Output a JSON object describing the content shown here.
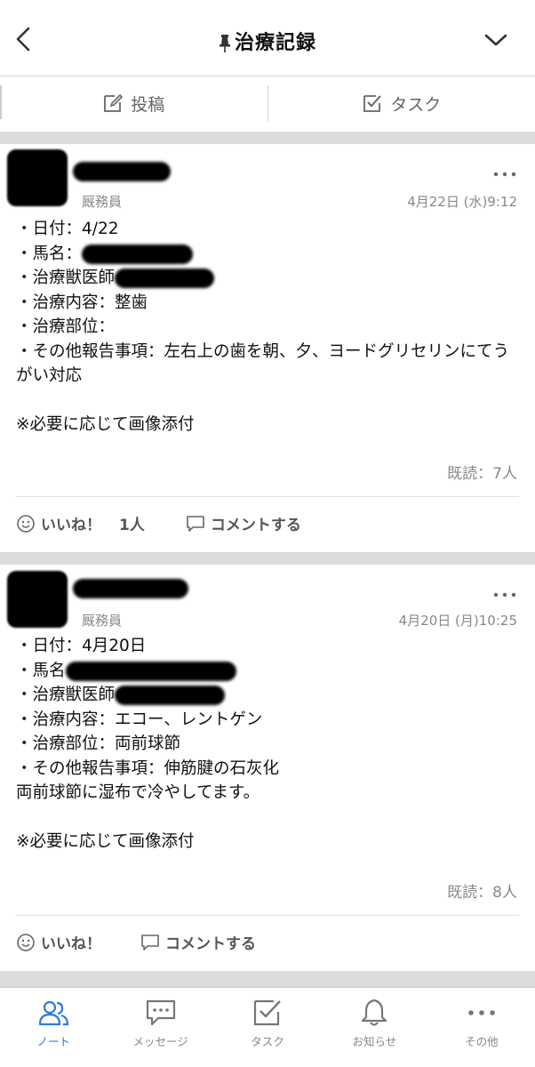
{
  "header": {
    "title": "治療記録",
    "back_icon": "chevron-left-icon",
    "pin_icon": "pin-icon",
    "menu_icon": "chevron-down-icon"
  },
  "actions": {
    "post_label": "投稿",
    "task_label": "タスク"
  },
  "posts": [
    {
      "role": "厩務員",
      "date": "4月22日 (水)9:12",
      "lines": {
        "date_label": "・日付：4/22",
        "horse_label": "・馬名：",
        "vet_label": "・治療獣医師",
        "content_label": "・治療内容：整歯",
        "site_label": "・治療部位：",
        "other_label": "・その他報告事項：左右上の歯を朝、夕、ヨードグリセリンにてうがい対応",
        "note": "※必要に応じて画像添付"
      },
      "read": "既読：7人",
      "like_label": "いいね！",
      "like_count": "1人",
      "comment_label": "コメントする"
    },
    {
      "role": "厩務員",
      "date": "4月20日 (月)10:25",
      "lines": {
        "date_label": "・日付：4月20日",
        "horse_label": "・馬名",
        "vet_label": "・治療獣医師",
        "content_label": "・治療内容：エコー、レントゲン",
        "site_label": "・治療部位：両前球節",
        "other_label": "・その他報告事項：伸筋腱の石灰化",
        "extra": "両前球節に湿布で冷やしてます。",
        "note": "※必要に応じて画像添付"
      },
      "read": "既読：8人",
      "like_label": "いいね！",
      "comment_label": "コメントする"
    }
  ],
  "bottom_nav": [
    {
      "label": "ノート",
      "icon": "people-icon",
      "active": true
    },
    {
      "label": "メッセージ",
      "icon": "chat-bubble-icon",
      "active": false
    },
    {
      "label": "タスク",
      "icon": "task-check-icon",
      "active": false
    },
    {
      "label": "お知らせ",
      "icon": "bell-icon",
      "active": false
    },
    {
      "label": "その他",
      "icon": "more-dots-icon",
      "active": false
    }
  ],
  "colors": {
    "accent": "#2e7ad8",
    "gap": "#dcdcdc"
  }
}
